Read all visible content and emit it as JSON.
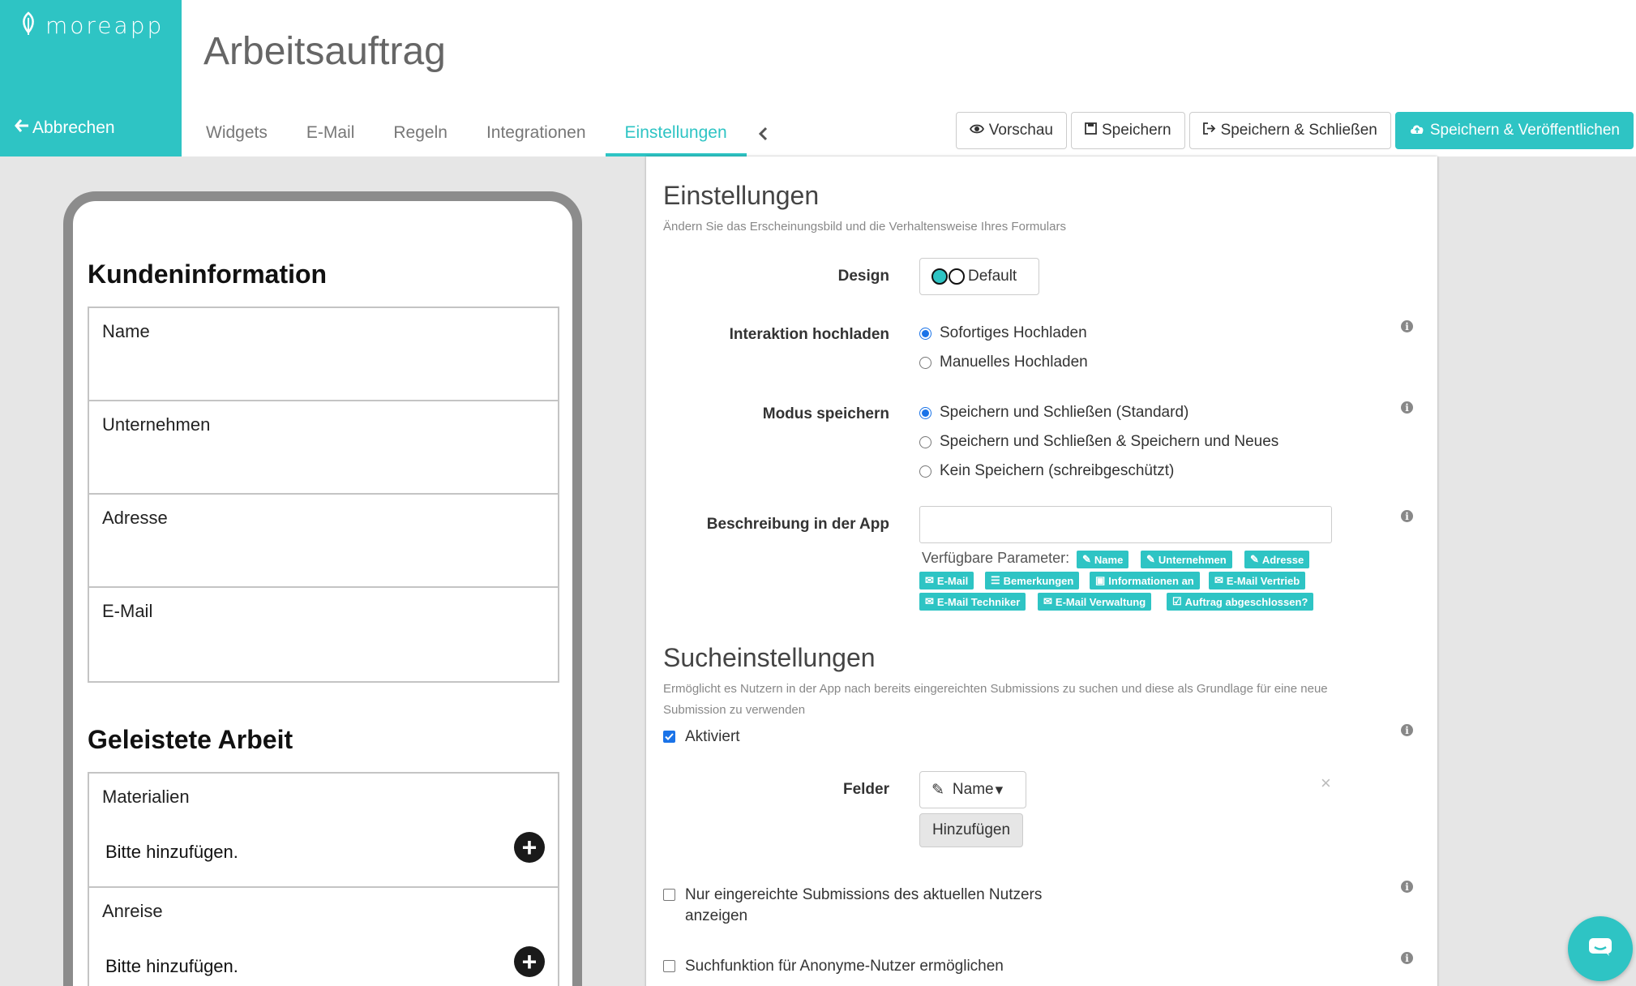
{
  "brand": {
    "logo_text": "moreapp",
    "cancel_label": "Abbrechen"
  },
  "page_title": "Arbeitsauftrag",
  "tabs": [
    {
      "label": "Widgets"
    },
    {
      "label": "E-Mail"
    },
    {
      "label": "Regeln"
    },
    {
      "label": "Integrationen"
    },
    {
      "label": "Einstellungen",
      "active": true
    }
  ],
  "actions": {
    "preview": "Vorschau",
    "save": "Speichern",
    "save_close": "Speichern & Schließen",
    "save_publish": "Speichern & Veröffentlichen"
  },
  "preview": {
    "section1": {
      "title": "Kundeninformation",
      "fields": [
        "Name",
        "Unternehmen",
        "Adresse",
        "E-Mail"
      ]
    },
    "section2": {
      "title": "Geleistete Arbeit",
      "fields": [
        {
          "label": "Materialien",
          "hint": "Bitte hinzufügen."
        },
        {
          "label": "Anreise",
          "hint": "Bitte hinzufügen."
        }
      ]
    }
  },
  "settings": {
    "title": "Einstellungen",
    "subtitle": "Ändern Sie das Erscheinungsbild und die Verhaltensweise Ihres Formulars",
    "design": {
      "label": "Design",
      "value": "Default"
    },
    "upload": {
      "label": "Interaktion hochladen",
      "options": [
        "Sofortiges Hochladen",
        "Manuelles Hochladen"
      ],
      "selected": 0
    },
    "save_mode": {
      "label": "Modus speichern",
      "options": [
        "Speichern und Schließen (Standard)",
        "Speichern und Schließen & Speichern und Neues",
        "Kein Speichern (schreibgeschützt)"
      ],
      "selected": 0
    },
    "description": {
      "label": "Beschreibung in der App",
      "value": "",
      "params_label": "Verfügbare Parameter:",
      "params": [
        {
          "label": "Name",
          "icon": "edit-icon"
        },
        {
          "label": "Unternehmen",
          "icon": "edit-icon"
        },
        {
          "label": "Adresse",
          "icon": "edit-icon"
        },
        {
          "label": "E-Mail",
          "icon": "envelope-icon"
        },
        {
          "label": "Bemerkungen",
          "icon": "list-icon"
        },
        {
          "label": "Informationen an",
          "icon": "select-icon"
        },
        {
          "label": "E-Mail Vertrieb",
          "icon": "envelope-icon"
        },
        {
          "label": "E-Mail Techniker",
          "icon": "envelope-icon"
        },
        {
          "label": "E-Mail Verwaltung",
          "icon": "envelope-icon"
        },
        {
          "label": "Auftrag abgeschlossen?",
          "icon": "checkbox-icon"
        }
      ]
    }
  },
  "search": {
    "title": "Sucheinstellungen",
    "subtitle_line1": "Ermöglicht es Nutzern in der App nach bereits eingereichten Submissions zu suchen und diese als Grundlage für eine neue",
    "subtitle_line2": "Submission zu verwenden",
    "enabled_label": "Aktiviert",
    "enabled": true,
    "fields_label": "Felder",
    "field_value": "Name",
    "add_label": "Hinzufügen",
    "own_label_line1": "Nur eingereichte Submissions des aktuellen Nutzers",
    "own_label_line2": "anzeigen",
    "anon_label": "Suchfunktion für Anonyme-Nutzer ermöglichen"
  },
  "colors": {
    "accent": "#2ec4c4",
    "radio": "#1a73e8"
  }
}
